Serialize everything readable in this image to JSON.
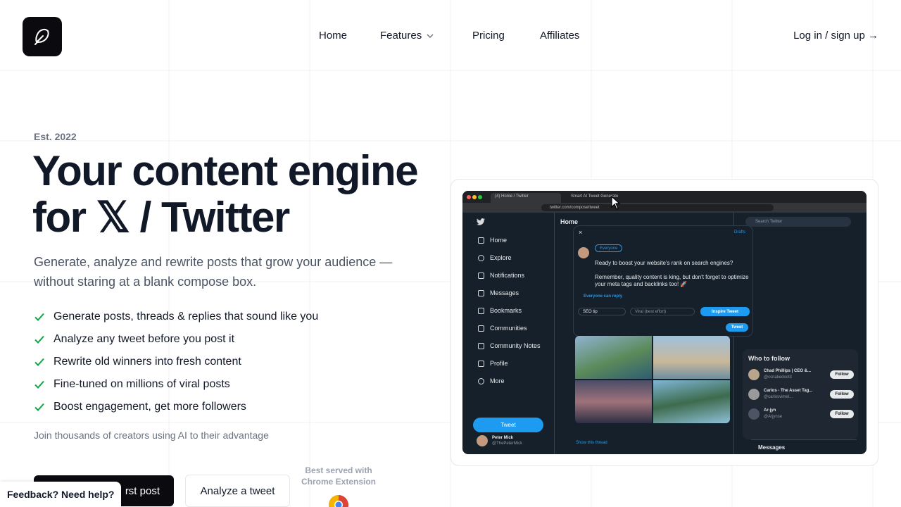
{
  "brand": {
    "logo_icon": "feather-icon"
  },
  "nav": {
    "home": "Home",
    "features": "Features",
    "pricing": "Pricing",
    "affiliates": "Affiliates",
    "login": "Log in / sign up →"
  },
  "hero": {
    "est": "Est. 2022",
    "headline_line1": "Your content engine",
    "headline_line2": "for 𝕏 / Twitter",
    "subtitle": "Generate, analyze and rewrite posts that grow your audience — without staring at a blank compose box.",
    "features": [
      "Generate posts, threads & replies that sound like you",
      "Analyze any tweet before you post it",
      "Rewrite old winners into fresh content",
      "Fine-tuned on millions of viral posts",
      "Boost engagement, get more followers"
    ],
    "social_proof": "Join thousands of creators using AI to their advantage",
    "cta_primary": "rst post",
    "cta_secondary": "Analyze a tweet",
    "served_with": "Best served with Chrome Extension"
  },
  "feedback": "Feedback? Need help?",
  "screenshot": {
    "tabs": [
      "(4) Home / Twitter",
      "Smart AI Tweet Generato"
    ],
    "url": "twitter.com/compose/tweet",
    "sidebar": [
      "Home",
      "Explore",
      "Notifications",
      "Messages",
      "Bookmarks",
      "Communities",
      "Community Notes",
      "Profile",
      "More"
    ],
    "tweet_button": "Tweet",
    "profile_name": "Peter Mick",
    "profile_handle": "@ThePeterMick",
    "main_title": "Home",
    "modal": {
      "drafts": "Drafts",
      "audience": "Everyone",
      "line1": "Ready to boost your website's rank on search engines?",
      "line2": "Remember, quality content is king, but don't forget to optimize your meta tags and backlinks too! 🚀",
      "reply_setting": "Everyone can reply",
      "topic_input": "SEO tip",
      "mode_select": "Viral (best effort)",
      "inspire_button": "Inspire Tweet",
      "tweet_button": "Tweet"
    },
    "show_thread": "Show this thread",
    "search_placeholder": "Search Twitter",
    "who_to_follow": "Who to follow",
    "follow_suggestions": [
      {
        "name": "Chad Phillips | CEO &...",
        "handle": "@csnakedoct3"
      },
      {
        "name": "Carlos - The Asset Tag...",
        "handle": "@carlosvimel..."
      },
      {
        "name": "Ar-jyn",
        "handle": "@Arjynse"
      }
    ],
    "follow_label": "Follow",
    "messages": "Messages"
  }
}
